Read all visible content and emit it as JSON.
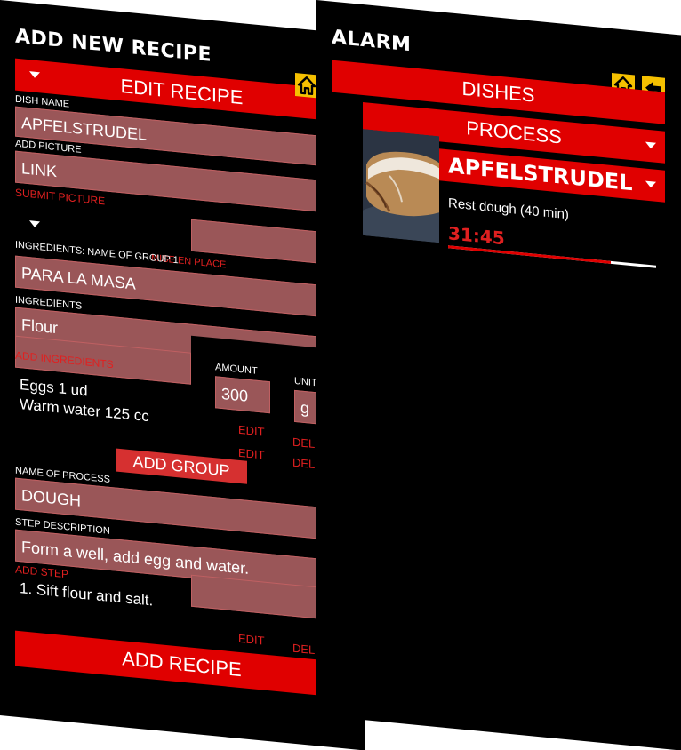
{
  "left": {
    "title": "ADD NEW RECIPE",
    "edit_recipe": "EDIT RECIPE",
    "dish_name_label": "DISH NAME",
    "dish_name_value": "APFELSTRUDEL",
    "add_picture_label": "ADD PICTURE",
    "add_picture_value": "LINK",
    "submit_picture": "SUBMIT PICTURE",
    "mise_en_place": "MISE EN PLACE",
    "ingredients_group_label": "INGREDIENTS: NAME OF GROUP 1",
    "group_value": "PARA LA MASA",
    "ingredients_label": "INGREDIENTS",
    "ingredient_value": "Flour",
    "add_ingredients": "ADD INGREDIENTS",
    "amount_label": "AMOUNT",
    "amount_value": "300",
    "unit_label": "UNIT",
    "unit_value": "g",
    "ingredient_list": [
      "Eggs 1 ud",
      "Warm water 125 cc"
    ],
    "edit": "EDIT",
    "delete": "DELETE",
    "add_group": "ADD GROUP",
    "process_label": "NAME OF PROCESS",
    "process_value": "DOUGH",
    "step_label": "STEP DESCRIPTION",
    "step_value": "Form a well, add egg and water.",
    "add_step": "ADD STEP",
    "step_list": [
      "1. Sift flour and salt."
    ],
    "add_recipe": "ADD RECIPE"
  },
  "right": {
    "title": "ALARM",
    "dishes": "DISHES",
    "process": "PROCESS",
    "dish_title": "APFELSTRUDEL",
    "step_text": "Rest dough (40 min)",
    "timer": "31:45",
    "progress": 0.78
  },
  "icons": {
    "home": "home-icon",
    "back": "back-arrow-icon",
    "dropdown": "chevron-down-icon"
  },
  "colors": {
    "accent": "#e00000",
    "field": "#9a5658",
    "icon_bg": "#f5c000"
  }
}
